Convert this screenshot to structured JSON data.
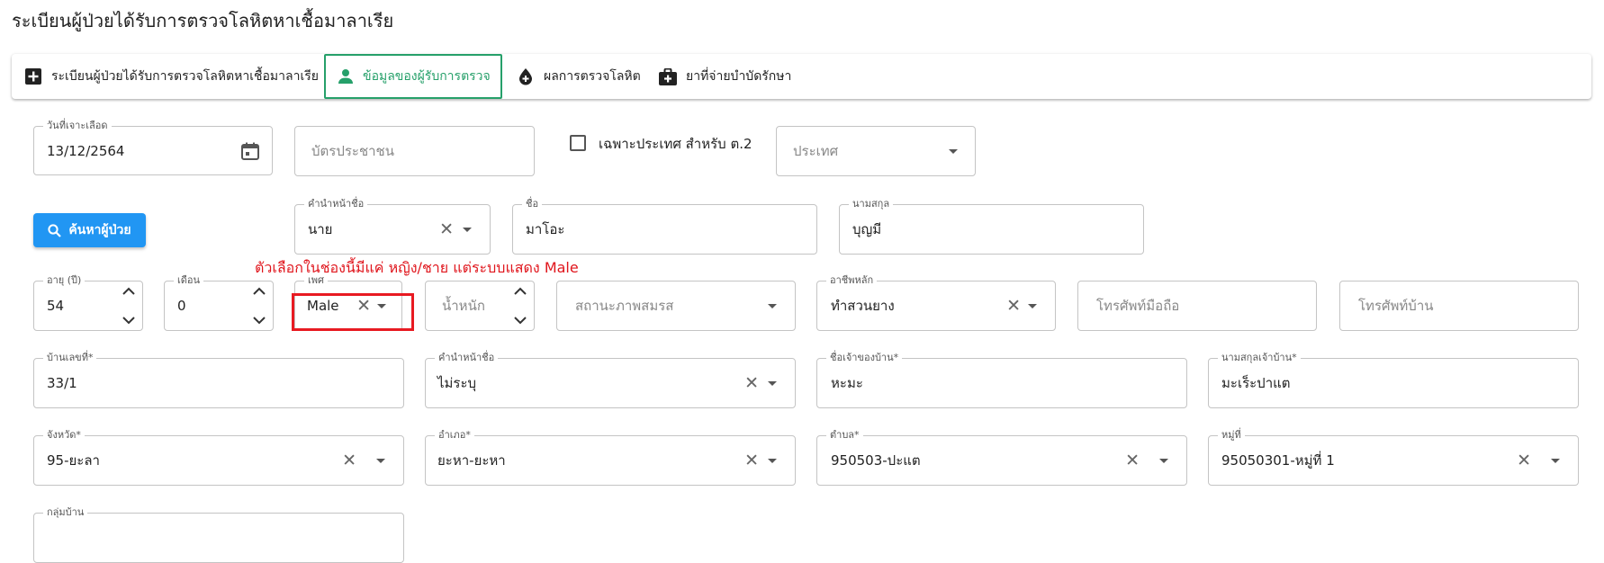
{
  "page": {
    "title": "ระเบียนผู้ป่วยได้รับการตรวจโลหิตหาเชื้อมาลาเรีย"
  },
  "tabs": [
    {
      "label": "ระเบียนผู้ป่วยได้รับการตรวจโลหิตหาเชื้อมาลาเรีย",
      "icon": "plus-box-icon",
      "active": false
    },
    {
      "label": "ข้อมูลของผู้รับการตรวจ",
      "icon": "person-icon",
      "active": true
    },
    {
      "label": "ผลการตรวจโลหิต",
      "icon": "blood-drop-icon",
      "active": false
    },
    {
      "label": "ยาที่จ่ายบำบัดรักษา",
      "icon": "medical-bag-icon",
      "active": false
    }
  ],
  "form": {
    "draw_date": {
      "label": "วันที่เจาะเลือด",
      "value": "13/12/2564"
    },
    "citizen_id": {
      "placeholder": "บัตรประชาชน"
    },
    "foreign_only": {
      "label": "เฉพาะประเทศ สำหรับ ต.2",
      "checked": false
    },
    "country": {
      "placeholder": "ประเทศ"
    },
    "search_button": {
      "label": "ค้นหาผู้ป่วย"
    },
    "prefix": {
      "label": "คำนำหน้าชื่อ",
      "value": "นาย"
    },
    "first_name": {
      "label": "ชื่อ",
      "value": "มาโอะ"
    },
    "last_name": {
      "label": "นามสกุล",
      "value": "บุญมี"
    },
    "age_years": {
      "label": "อายุ (ปี)",
      "value": "54"
    },
    "age_months": {
      "label": "เดือน",
      "value": "0"
    },
    "sex": {
      "label": "เพศ",
      "value": "Male"
    },
    "weight": {
      "placeholder": "น้ำหนัก"
    },
    "marital_status": {
      "placeholder": "สถานะภาพสมรส"
    },
    "occupation": {
      "label": "อาชีพหลัก",
      "value": "ทำสวนยาง"
    },
    "mobile_phone": {
      "placeholder": "โทรศัพท์มือถือ"
    },
    "home_phone": {
      "placeholder": "โทรศัพท์บ้าน"
    },
    "house_no": {
      "label": "บ้านเลขที่*",
      "value": "33/1"
    },
    "owner_prefix": {
      "label": "คำนำหน้าชื่อ",
      "value": "ไม่ระบุ"
    },
    "owner_first_name": {
      "label": "ชื่อเจ้าของบ้าน*",
      "value": "หะมะ"
    },
    "owner_last_name": {
      "label": "นามสกุลเจ้าบ้าน*",
      "value": "มะเร็ะปาแต"
    },
    "province": {
      "label": "จังหวัด*",
      "value": "95-ยะลา"
    },
    "district": {
      "label": "อำเภอ*",
      "value": "ยะหา-ยะหา"
    },
    "subdistrict": {
      "label": "ตำบล*",
      "value": "950503-ปะแต"
    },
    "village": {
      "label": "หมู่ที่",
      "value": "95050301-หมู่ที่ 1"
    },
    "house_group": {
      "label": "กลุ่มบ้าน"
    }
  },
  "annotation": {
    "text": "ตัวเลือกในช่องนี้มีแค่ หญิง/ชาย แต่ระบบแสดง Male",
    "color": "#e0151c"
  },
  "colors": {
    "accent_green": "#26a06a",
    "primary_blue": "#2196f3",
    "highlight_red": "#e81a22"
  },
  "glyphs": {
    "clear": "✕"
  }
}
